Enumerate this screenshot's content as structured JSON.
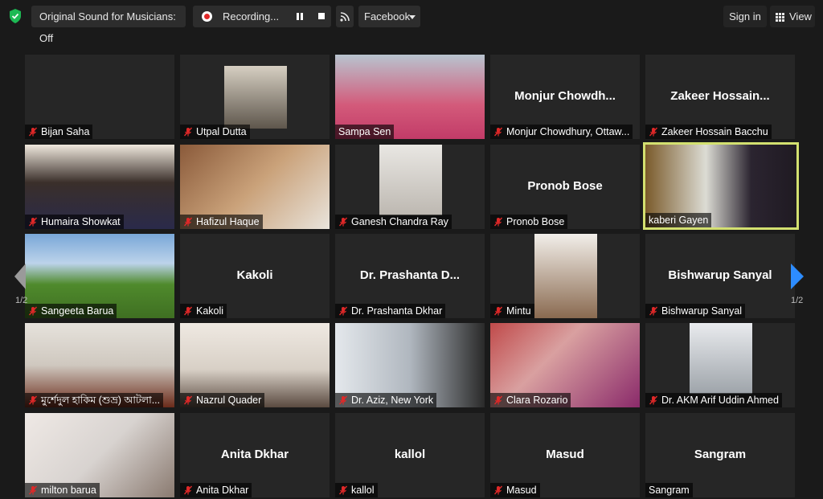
{
  "toolbar": {
    "original_sound": "Original Sound for Musicians: Off",
    "recording": "Recording...",
    "facebook": "Facebook",
    "sign_in": "Sign in",
    "view": "View"
  },
  "colors": {
    "active_border": "#d3e070",
    "muted_mic": "#e02828",
    "nav_arrow_right": "#2d8cff",
    "recording_dot": "#e02828"
  },
  "participants": [
    {
      "name": "Bijan Saha",
      "display": "",
      "muted": true,
      "video": "off"
    },
    {
      "name": "Utpal Dutta",
      "display": "",
      "muted": true,
      "video": "photo"
    },
    {
      "name": "Sampa Sen",
      "display": "",
      "muted": false,
      "video": "on"
    },
    {
      "name": "Monjur Chowdhury, Ottaw...",
      "display": "Monjur  Chowdh...",
      "muted": true,
      "video": "off"
    },
    {
      "name": "Zakeer Hossain Bacchu",
      "display": "Zakeer  Hossain...",
      "muted": true,
      "video": "off"
    },
    {
      "name": "Humaira Showkat",
      "display": "",
      "muted": true,
      "video": "on"
    },
    {
      "name": "Hafizul Haque",
      "display": "",
      "muted": true,
      "video": "on"
    },
    {
      "name": "Ganesh Chandra Ray",
      "display": "",
      "muted": true,
      "video": "on"
    },
    {
      "name": "Pronob Bose",
      "display": "Pronob Bose",
      "muted": true,
      "video": "off"
    },
    {
      "name": "kaberi Gayen",
      "display": "",
      "muted": false,
      "video": "on",
      "active_speaker": true
    },
    {
      "name": "Sangeeta Barua",
      "display": "",
      "muted": true,
      "video": "on"
    },
    {
      "name": "Kakoli",
      "display": "Kakoli",
      "muted": true,
      "video": "off"
    },
    {
      "name": "Dr. Prashanta Dkhar",
      "display": "Dr. Prashanta  D...",
      "muted": true,
      "video": "off"
    },
    {
      "name": "Mintu",
      "display": "",
      "muted": true,
      "video": "on"
    },
    {
      "name": "Bishwarup Sanyal",
      "display": "Bishwarup Sanyal",
      "muted": true,
      "video": "off"
    },
    {
      "name": "মুর্শেদুল হাকিম (শুভ্র) আটলা...",
      "display": "",
      "muted": true,
      "video": "on"
    },
    {
      "name": "Nazrul Quader",
      "display": "",
      "muted": true,
      "video": "on"
    },
    {
      "name": "Dr. Aziz, New York",
      "display": "",
      "muted": true,
      "video": "on"
    },
    {
      "name": "Clara Rozario",
      "display": "",
      "muted": true,
      "video": "on"
    },
    {
      "name": "Dr. AKM Arif Uddin Ahmed",
      "display": "",
      "muted": true,
      "video": "on"
    },
    {
      "name": "milton barua",
      "display": "",
      "muted": true,
      "video": "on"
    },
    {
      "name": "Anita Dkhar",
      "display": "Anita Dkhar",
      "muted": true,
      "video": "off"
    },
    {
      "name": "kallol",
      "display": "kallol",
      "muted": true,
      "video": "off"
    },
    {
      "name": "Masud",
      "display": "Masud",
      "muted": true,
      "video": "off"
    },
    {
      "name": "Sangram",
      "display": "Sangram",
      "muted": false,
      "video": "off"
    }
  ],
  "pagination": {
    "left": "1/2",
    "right": "1/2"
  }
}
